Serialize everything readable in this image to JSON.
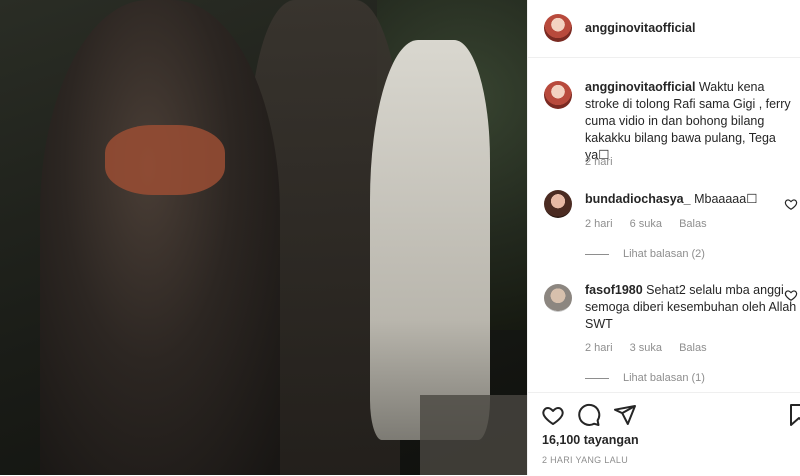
{
  "post": {
    "username": "angginovitaofficial",
    "caption_username": "angginovitaofficial",
    "caption": "Waktu kena stroke di tolong Rafi sama Gigi , ferry cuma vidio in dan bohong bilang kakakku bilang bawa pulang, Tega ya☐",
    "caption_time": "2 hari",
    "views": "16,100 tayangan",
    "date": "2 HARI YANG LALU"
  },
  "comments": [
    {
      "username": "bundadiochasya_",
      "text": "Mbaaaaa☐",
      "time": "2 hari",
      "likes": "6 suka",
      "reply": "Balas",
      "view_replies": "Lihat balasan (2)"
    },
    {
      "username": "fasof1980",
      "text": "Sehat2 selalu mba anggi, semoga diberi kesembuhan oleh Allah SWT",
      "time": "2 hari",
      "likes": "3 suka",
      "reply": "Balas",
      "view_replies": "Lihat balasan (1)"
    }
  ],
  "colors": {
    "text": "#262626",
    "secondary": "#8e8e8e",
    "divider": "#efefef"
  },
  "icons": [
    "heart-icon",
    "comment-icon",
    "share-icon",
    "bookmark-icon"
  ]
}
